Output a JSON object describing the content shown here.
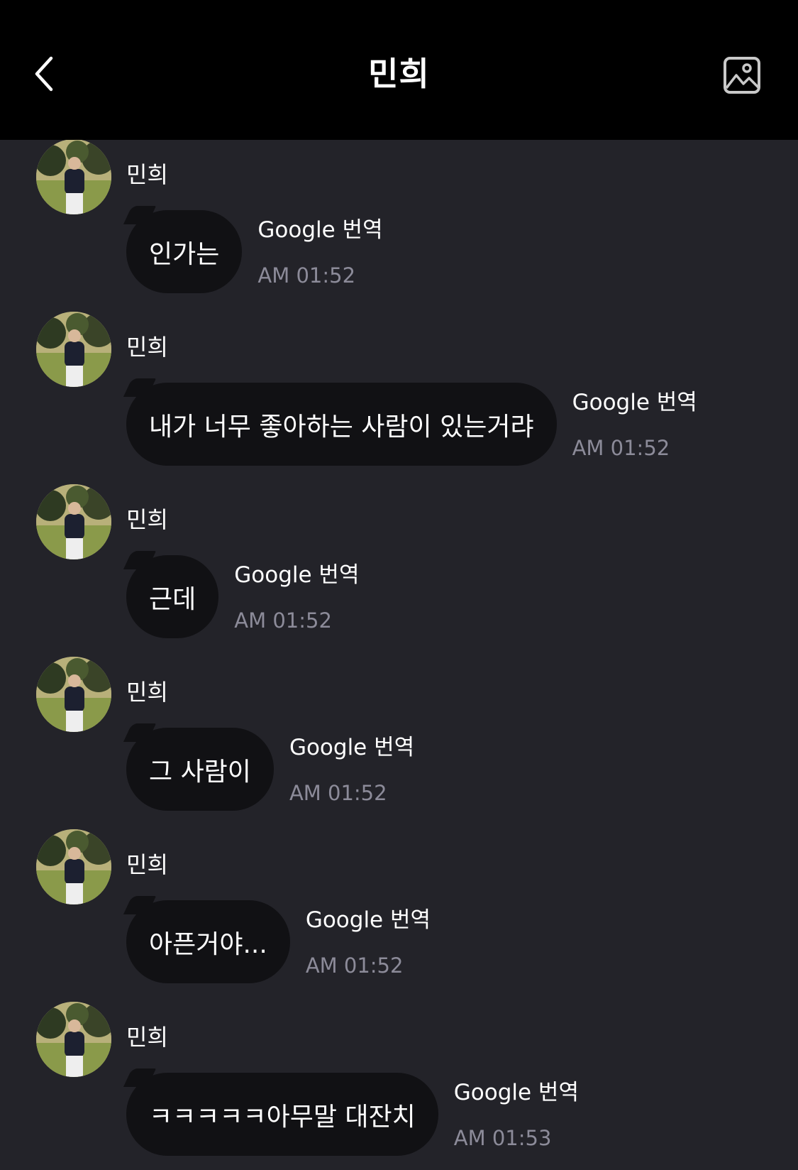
{
  "header": {
    "title": "민희",
    "back_icon": "chevron-left-icon",
    "gallery_icon": "image-icon"
  },
  "messages": [
    {
      "sender": "민희",
      "text": "인가는",
      "translate": "Google 번역",
      "time": "AM 01:52"
    },
    {
      "sender": "민희",
      "text": "내가 너무 좋아하는 사람이 있는거랴",
      "translate": "Google 번역",
      "time": "AM 01:52"
    },
    {
      "sender": "민희",
      "text": "근데",
      "translate": "Google 번역",
      "time": "AM 01:52"
    },
    {
      "sender": "민희",
      "text": "그 사람이",
      "translate": "Google 번역",
      "time": "AM 01:52"
    },
    {
      "sender": "민희",
      "text": "아픈거야...",
      "translate": "Google 번역",
      "time": "AM 01:52"
    },
    {
      "sender": "민희",
      "text": "ㅋㅋㅋㅋㅋ아무말 대잔치",
      "translate": "Google 번역",
      "time": "AM 01:53"
    }
  ],
  "colors": {
    "background": "#232329",
    "header": "#000000",
    "bubble": "#111114",
    "timestamp": "#8c8b99"
  }
}
